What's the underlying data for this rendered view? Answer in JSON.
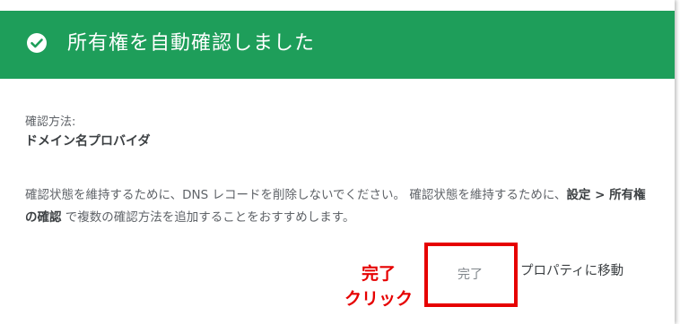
{
  "dialog": {
    "title": "所有権を自動確認しました",
    "method_label": "確認方法:",
    "method_value": "ドメイン名プロバイダ",
    "body_before": "確認状態を維持するために、DNS レコードを削除しないでください。 確認状態を維持するために、",
    "body_bold": "設定 > 所有権の確認",
    "body_after": " で複数の確認方法を追加することをおすすめします。",
    "done_label": "完了",
    "goto_label": "プロパティに移動"
  },
  "annotation": {
    "line1": "完了",
    "line2": "クリック"
  },
  "colors": {
    "header_bg": "#1e9e5a",
    "highlight": "#e60000"
  },
  "icons": {
    "header_icon": "check-circle-icon"
  }
}
